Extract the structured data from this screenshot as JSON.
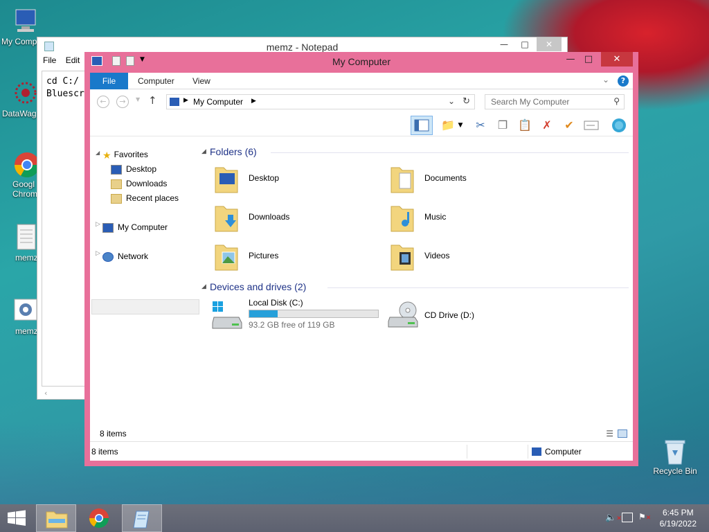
{
  "desktop": {
    "icons": [
      {
        "label": "My Comp"
      },
      {
        "label": "DataWag"
      },
      {
        "label": "Googl Chrom"
      },
      {
        "label": "memz"
      },
      {
        "label": "memz"
      },
      {
        "label": "Recycle Bin"
      }
    ]
  },
  "notepad": {
    "title": "memz - Notepad",
    "menu": [
      "File",
      "Edit"
    ],
    "lines": [
      "cd C:/",
      "Bluescr"
    ]
  },
  "explorer": {
    "title": "My Computer",
    "tabs": {
      "file": "File",
      "computer": "Computer",
      "view": "View"
    },
    "address": "My Computer",
    "search_placeholder": "Search My Computer",
    "nav": {
      "favorites": "Favorites",
      "desktop": "Desktop",
      "downloads": "Downloads",
      "recent": "Recent places",
      "my_computer": "My Computer",
      "network": "Network"
    },
    "folders_header": "Folders (6)",
    "folders": [
      "Desktop",
      "Documents",
      "Downloads",
      "Music",
      "Pictures",
      "Videos"
    ],
    "devices_header": "Devices and drives (2)",
    "drives": {
      "c_label": "Local Disk (C:)",
      "c_free": "93.2 GB free of 119 GB",
      "c_used_fraction": 0.22,
      "d_label": "CD Drive (D:)"
    },
    "status_count": "8 items",
    "status_count_bottom": "8 items",
    "status_location": "Computer"
  },
  "taskbar": {
    "time": "6:45 PM",
    "date": "6/19/2022"
  },
  "colors": {
    "explorer_frame": "#e8709a",
    "file_tab": "#1979ca",
    "header_text": "#1e3287"
  }
}
